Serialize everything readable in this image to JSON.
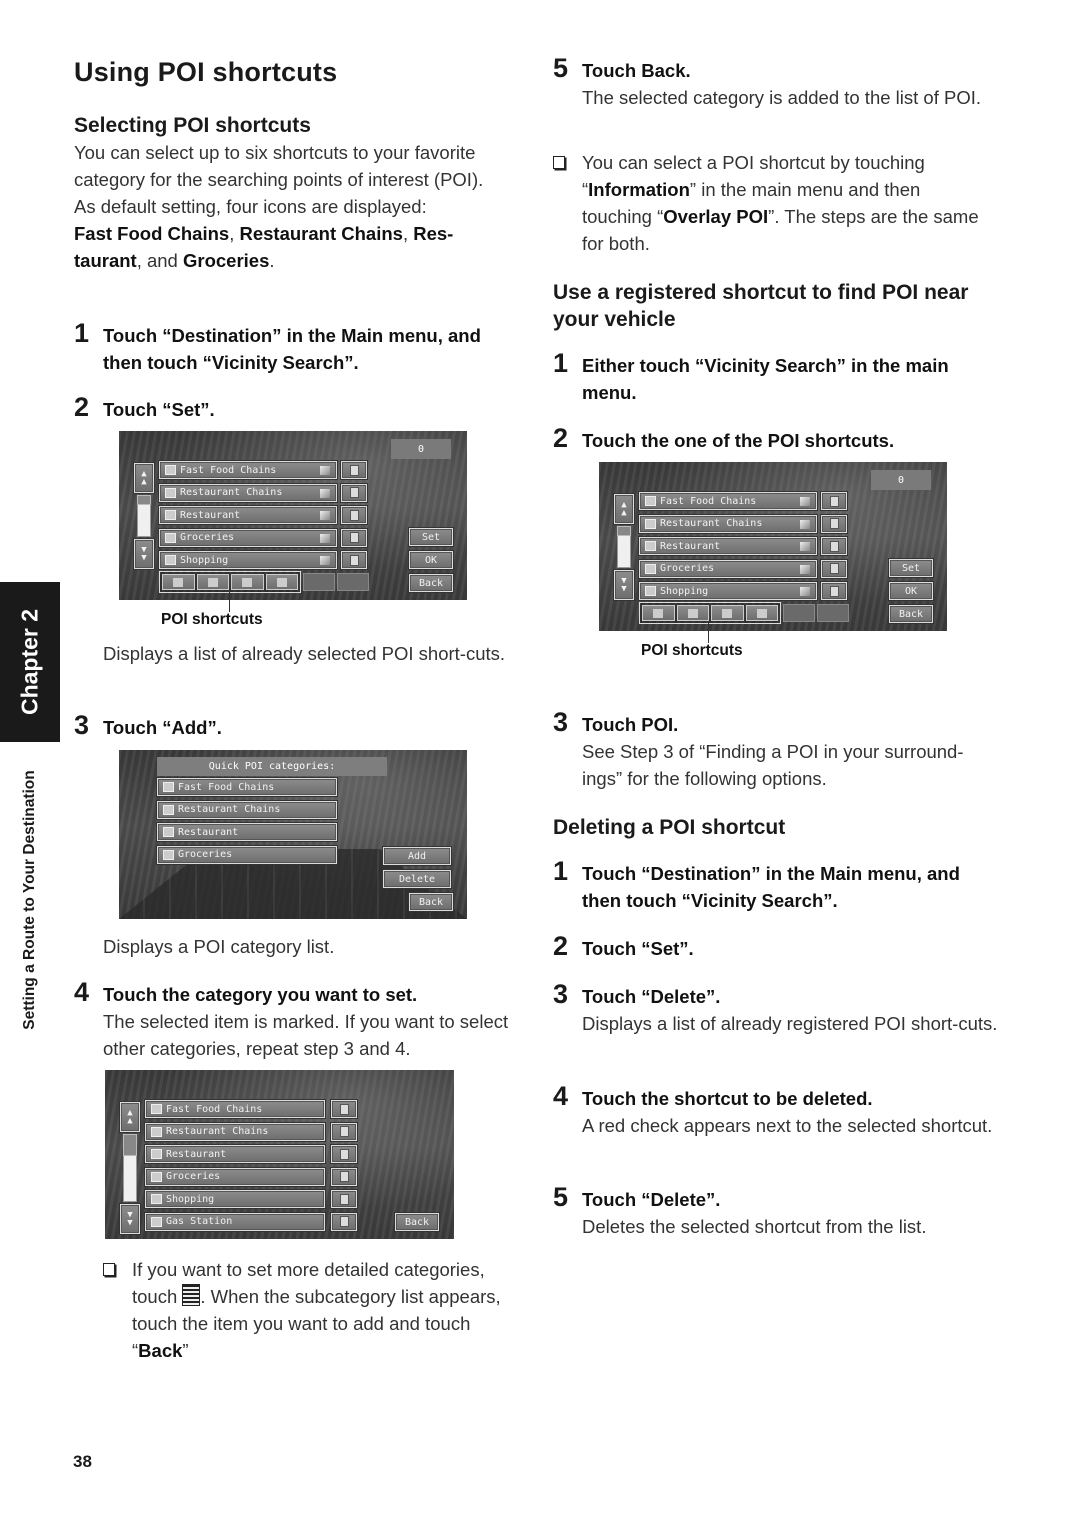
{
  "page": {
    "title": "Using POI shortcuts",
    "page_number": "38",
    "chapter_tab": "Chapter 2",
    "side_label": "Setting a Route to Your Destination"
  },
  "left": {
    "section_title": "Selecting POI shortcuts",
    "intro": "You can select up to six shortcuts to your favorite category for the searching points of interest (POI).",
    "default_line": "As default setting, four icons are displayed:",
    "defaults": [
      "Fast Food Chains",
      "Restaurant Chains",
      "Res-taurant",
      "Groceries"
    ],
    "defaults_sep": [
      ", ",
      ", ",
      ", and ",
      "."
    ],
    "steps": [
      {
        "num": "1",
        "title": "Touch “Destination” in the Main menu, and then touch “Vicinity Search”."
      },
      {
        "num": "2",
        "title": "Touch “Set”.",
        "callout": "POI shortcuts",
        "desc": "Displays a list of already selected POI short-cuts."
      },
      {
        "num": "3",
        "title": "Touch “Add”.",
        "desc": "Displays a POI category list."
      },
      {
        "num": "4",
        "title": "Touch the category you want to set.",
        "desc": "The selected item is marked. If you want to select other categories, repeat step 3 and 4."
      }
    ],
    "note": {
      "pre": "If you want to set more detailed categories, touch ",
      "icon": "subcategory-doc-icon",
      "mid": ". When the subcategory list appears, touch the item you want to add and touch “",
      "bold": "Back",
      "post": "”"
    }
  },
  "right": {
    "step5": {
      "num": "5",
      "title": "Touch Back.",
      "desc": "The selected category is added to the list of POI."
    },
    "note": {
      "p1": "You can select a POI shortcut by touching “",
      "b1": "Information",
      "p2": "” in the main menu and then touching “",
      "b2": "Overlay POI",
      "p3": "”. The steps are the same for both."
    },
    "section2_title": "Use a registered shortcut to find POI near your vehicle",
    "section2_steps": [
      {
        "num": "1",
        "title": "Either touch “Vicinity Search” in the main menu."
      },
      {
        "num": "2",
        "title": "Touch the one of the POI shortcuts.",
        "callout": "POI shortcuts"
      },
      {
        "num": "3",
        "title": "Touch POI.",
        "desc": "See Step 3 of “Finding a POI in your surround-ings” for the following options."
      }
    ],
    "section3_title": "Deleting a POI shortcut",
    "section3_steps": [
      {
        "num": "1",
        "title": "Touch “Destination” in the Main menu, and then touch “Vicinity Search”."
      },
      {
        "num": "2",
        "title": "Touch “Set”."
      },
      {
        "num": "3",
        "title": "Touch “Delete”.",
        "desc": "Displays a list of already registered POI short-cuts."
      },
      {
        "num": "4",
        "title": "Touch the shortcut to be deleted.",
        "desc": "A red check appears next to the selected shortcut."
      },
      {
        "num": "5",
        "title": "Touch “Delete”.",
        "desc": "Deletes the selected shortcut from the list."
      }
    ]
  },
  "screens": {
    "shortcut_list": {
      "counter": "0",
      "items": [
        {
          "label": "Fast Food Chains",
          "icon": "burger-icon"
        },
        {
          "label": "Restaurant Chains",
          "icon": "fork-knife-icon"
        },
        {
          "label": "Restaurant",
          "icon": "restaurant-icon"
        },
        {
          "label": "Groceries",
          "icon": "grocery-cart-icon"
        },
        {
          "label": "Shopping",
          "icon": "shopping-bag-icon"
        }
      ],
      "buttons": {
        "set": "Set",
        "ok": "OK",
        "back": "Back"
      },
      "shortcut_icons": [
        "burger-icon",
        "fork-knife-icon",
        "restaurant-icon",
        "grocery-cart-icon"
      ],
      "empty_slots": 2
    },
    "quick_categories": {
      "header": "Quick POI categories:",
      "items": [
        {
          "label": "Fast Food Chains",
          "icon": "burger-icon"
        },
        {
          "label": "Restaurant Chains",
          "icon": "fork-knife-icon"
        },
        {
          "label": "Restaurant",
          "icon": "restaurant-icon"
        },
        {
          "label": "Groceries",
          "icon": "grocery-cart-icon"
        }
      ],
      "buttons": {
        "add": "Add",
        "delete": "Delete",
        "back": "Back"
      }
    },
    "category_select": {
      "items": [
        {
          "label": "Fast Food Chains",
          "icon": "burger-icon"
        },
        {
          "label": "Restaurant Chains",
          "icon": "fork-knife-icon"
        },
        {
          "label": "Restaurant",
          "icon": "restaurant-icon"
        },
        {
          "label": "Groceries",
          "icon": "grocery-cart-icon"
        },
        {
          "label": "Shopping",
          "icon": "shopping-bag-icon"
        },
        {
          "label": "Gas Station",
          "icon": "gas-pump-icon"
        }
      ],
      "buttons": {
        "back": "Back"
      }
    }
  }
}
